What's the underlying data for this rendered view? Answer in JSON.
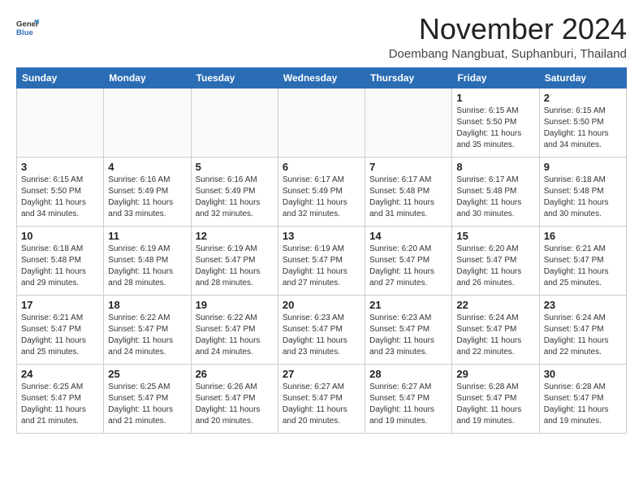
{
  "header": {
    "logo": {
      "general": "General",
      "blue": "Blue"
    },
    "title": "November 2024",
    "subtitle": "Doembang Nangbuat, Suphanburi, Thailand"
  },
  "calendar": {
    "weekdays": [
      "Sunday",
      "Monday",
      "Tuesday",
      "Wednesday",
      "Thursday",
      "Friday",
      "Saturday"
    ],
    "weeks": [
      [
        {
          "day": "",
          "info": ""
        },
        {
          "day": "",
          "info": ""
        },
        {
          "day": "",
          "info": ""
        },
        {
          "day": "",
          "info": ""
        },
        {
          "day": "",
          "info": ""
        },
        {
          "day": "1",
          "info": "Sunrise: 6:15 AM\nSunset: 5:50 PM\nDaylight: 11 hours\nand 35 minutes."
        },
        {
          "day": "2",
          "info": "Sunrise: 6:15 AM\nSunset: 5:50 PM\nDaylight: 11 hours\nand 34 minutes."
        }
      ],
      [
        {
          "day": "3",
          "info": "Sunrise: 6:15 AM\nSunset: 5:50 PM\nDaylight: 11 hours\nand 34 minutes."
        },
        {
          "day": "4",
          "info": "Sunrise: 6:16 AM\nSunset: 5:49 PM\nDaylight: 11 hours\nand 33 minutes."
        },
        {
          "day": "5",
          "info": "Sunrise: 6:16 AM\nSunset: 5:49 PM\nDaylight: 11 hours\nand 32 minutes."
        },
        {
          "day": "6",
          "info": "Sunrise: 6:17 AM\nSunset: 5:49 PM\nDaylight: 11 hours\nand 32 minutes."
        },
        {
          "day": "7",
          "info": "Sunrise: 6:17 AM\nSunset: 5:48 PM\nDaylight: 11 hours\nand 31 minutes."
        },
        {
          "day": "8",
          "info": "Sunrise: 6:17 AM\nSunset: 5:48 PM\nDaylight: 11 hours\nand 30 minutes."
        },
        {
          "day": "9",
          "info": "Sunrise: 6:18 AM\nSunset: 5:48 PM\nDaylight: 11 hours\nand 30 minutes."
        }
      ],
      [
        {
          "day": "10",
          "info": "Sunrise: 6:18 AM\nSunset: 5:48 PM\nDaylight: 11 hours\nand 29 minutes."
        },
        {
          "day": "11",
          "info": "Sunrise: 6:19 AM\nSunset: 5:48 PM\nDaylight: 11 hours\nand 28 minutes."
        },
        {
          "day": "12",
          "info": "Sunrise: 6:19 AM\nSunset: 5:47 PM\nDaylight: 11 hours\nand 28 minutes."
        },
        {
          "day": "13",
          "info": "Sunrise: 6:19 AM\nSunset: 5:47 PM\nDaylight: 11 hours\nand 27 minutes."
        },
        {
          "day": "14",
          "info": "Sunrise: 6:20 AM\nSunset: 5:47 PM\nDaylight: 11 hours\nand 27 minutes."
        },
        {
          "day": "15",
          "info": "Sunrise: 6:20 AM\nSunset: 5:47 PM\nDaylight: 11 hours\nand 26 minutes."
        },
        {
          "day": "16",
          "info": "Sunrise: 6:21 AM\nSunset: 5:47 PM\nDaylight: 11 hours\nand 25 minutes."
        }
      ],
      [
        {
          "day": "17",
          "info": "Sunrise: 6:21 AM\nSunset: 5:47 PM\nDaylight: 11 hours\nand 25 minutes."
        },
        {
          "day": "18",
          "info": "Sunrise: 6:22 AM\nSunset: 5:47 PM\nDaylight: 11 hours\nand 24 minutes."
        },
        {
          "day": "19",
          "info": "Sunrise: 6:22 AM\nSunset: 5:47 PM\nDaylight: 11 hours\nand 24 minutes."
        },
        {
          "day": "20",
          "info": "Sunrise: 6:23 AM\nSunset: 5:47 PM\nDaylight: 11 hours\nand 23 minutes."
        },
        {
          "day": "21",
          "info": "Sunrise: 6:23 AM\nSunset: 5:47 PM\nDaylight: 11 hours\nand 23 minutes."
        },
        {
          "day": "22",
          "info": "Sunrise: 6:24 AM\nSunset: 5:47 PM\nDaylight: 11 hours\nand 22 minutes."
        },
        {
          "day": "23",
          "info": "Sunrise: 6:24 AM\nSunset: 5:47 PM\nDaylight: 11 hours\nand 22 minutes."
        }
      ],
      [
        {
          "day": "24",
          "info": "Sunrise: 6:25 AM\nSunset: 5:47 PM\nDaylight: 11 hours\nand 21 minutes."
        },
        {
          "day": "25",
          "info": "Sunrise: 6:25 AM\nSunset: 5:47 PM\nDaylight: 11 hours\nand 21 minutes."
        },
        {
          "day": "26",
          "info": "Sunrise: 6:26 AM\nSunset: 5:47 PM\nDaylight: 11 hours\nand 20 minutes."
        },
        {
          "day": "27",
          "info": "Sunrise: 6:27 AM\nSunset: 5:47 PM\nDaylight: 11 hours\nand 20 minutes."
        },
        {
          "day": "28",
          "info": "Sunrise: 6:27 AM\nSunset: 5:47 PM\nDaylight: 11 hours\nand 19 minutes."
        },
        {
          "day": "29",
          "info": "Sunrise: 6:28 AM\nSunset: 5:47 PM\nDaylight: 11 hours\nand 19 minutes."
        },
        {
          "day": "30",
          "info": "Sunrise: 6:28 AM\nSunset: 5:47 PM\nDaylight: 11 hours\nand 19 minutes."
        }
      ]
    ]
  }
}
